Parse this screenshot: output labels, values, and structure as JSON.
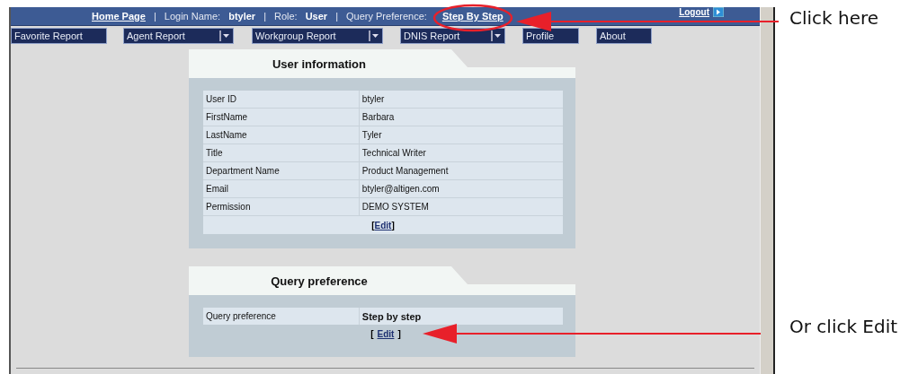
{
  "top_bar": {
    "items": [
      {
        "kind": "link",
        "text": "Home Page"
      },
      {
        "kind": "separator",
        "text": "|"
      },
      {
        "kind": "field",
        "label": "Login Name:",
        "value": "btyler"
      },
      {
        "kind": "separator",
        "text": "|"
      },
      {
        "kind": "field",
        "label": "Role:",
        "value": "User"
      },
      {
        "kind": "separator",
        "text": "|"
      },
      {
        "kind": "labelled_link",
        "label": "Query Preference:",
        "value": "Step By Step"
      }
    ],
    "logout": "Logout"
  },
  "nav": [
    {
      "label": "Favorite Report",
      "dropdown": false
    },
    {
      "label": "Agent Report",
      "dropdown": true
    },
    {
      "label": "Workgroup Report",
      "dropdown": true
    },
    {
      "label": "DNIS Report",
      "dropdown": true
    },
    {
      "label": "Profile",
      "dropdown": false
    },
    {
      "label": "About",
      "dropdown": false
    }
  ],
  "panels": [
    {
      "title": "User information",
      "rows": [
        {
          "label": "User ID",
          "value": "btyler",
          "emphasis": false
        },
        {
          "label": "FirstName",
          "value": "Barbara",
          "emphasis": false
        },
        {
          "label": "LastName",
          "value": "Tyler",
          "emphasis": false
        },
        {
          "label": "Title",
          "value": "Technical Writer",
          "emphasis": false
        },
        {
          "label": "Department Name",
          "value": "Product Management",
          "emphasis": false
        },
        {
          "label": "Email",
          "value": "btyler@altigen.com",
          "emphasis": false
        },
        {
          "label": "Permission",
          "value": "DEMO SYSTEM",
          "emphasis": false
        }
      ],
      "edit": {
        "before": "[",
        "link": "Edit",
        "after": "]",
        "spaced": false,
        "in_table": true
      }
    },
    {
      "title": "Query preference",
      "rows": [
        {
          "label": "Query preference",
          "value": "Step by step",
          "emphasis": true
        }
      ],
      "edit": {
        "before": "[",
        "link": "Edit",
        "after": "]",
        "spaced": true,
        "in_table": false
      }
    }
  ],
  "callouts": [
    {
      "text": "Click here"
    },
    {
      "text": "Or click Edit"
    }
  ]
}
